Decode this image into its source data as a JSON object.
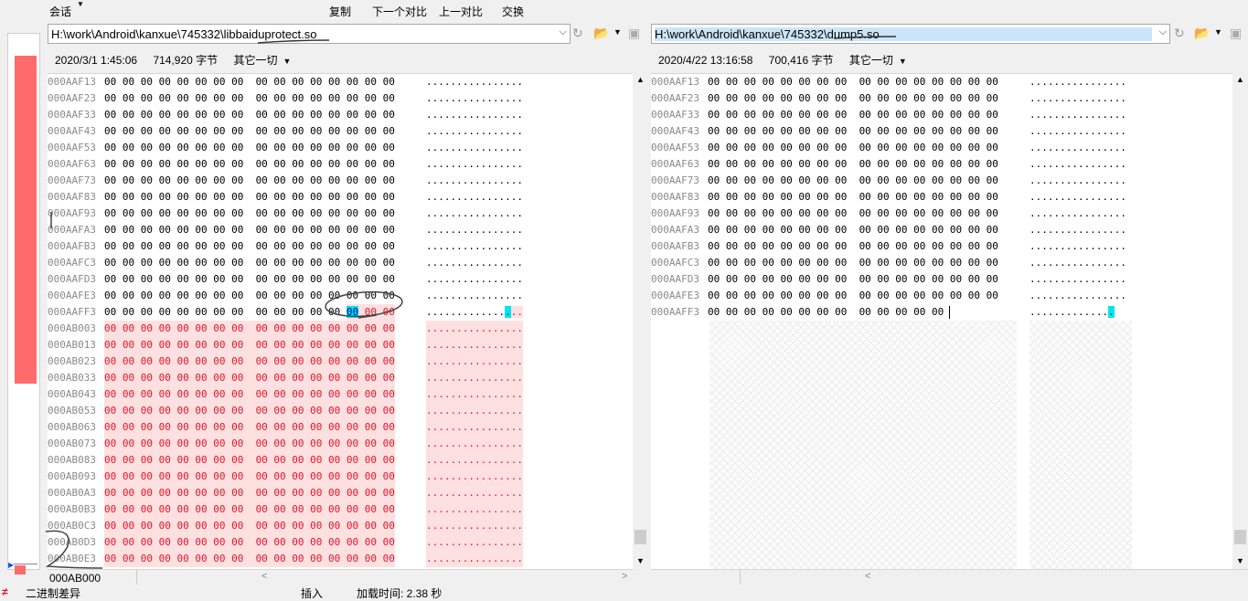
{
  "toolbar": {
    "session": "会话",
    "copy": "复制",
    "next_diff": "下一个对比",
    "prev_diff": "上一对比",
    "swap": "交换"
  },
  "left": {
    "path": "H:\\work\\Android\\kanxue\\745332\\libbaiduprotect.so",
    "date": "2020/3/1 1:45:06",
    "size": "714,920 字节",
    "encoding": "其它一切",
    "offset": "000AB000",
    "rows": [
      {
        "addr": "000AAF13",
        "bytes": "00 00 00 00 00 00 00 00  00 00 00 00 00 00 00 00",
        "ascii": "................",
        "diff": false
      },
      {
        "addr": "000AAF23",
        "bytes": "00 00 00 00 00 00 00 00  00 00 00 00 00 00 00 00",
        "ascii": "................",
        "diff": false
      },
      {
        "addr": "000AAF33",
        "bytes": "00 00 00 00 00 00 00 00  00 00 00 00 00 00 00 00",
        "ascii": "................",
        "diff": false
      },
      {
        "addr": "000AAF43",
        "bytes": "00 00 00 00 00 00 00 00  00 00 00 00 00 00 00 00",
        "ascii": "................",
        "diff": false
      },
      {
        "addr": "000AAF53",
        "bytes": "00 00 00 00 00 00 00 00  00 00 00 00 00 00 00 00",
        "ascii": "................",
        "diff": false
      },
      {
        "addr": "000AAF63",
        "bytes": "00 00 00 00 00 00 00 00  00 00 00 00 00 00 00 00",
        "ascii": "................",
        "diff": false
      },
      {
        "addr": "000AAF73",
        "bytes": "00 00 00 00 00 00 00 00  00 00 00 00 00 00 00 00",
        "ascii": "................",
        "diff": false
      },
      {
        "addr": "000AAF83",
        "bytes": "00 00 00 00 00 00 00 00  00 00 00 00 00 00 00 00",
        "ascii": "................",
        "diff": false
      },
      {
        "addr": "000AAF93",
        "bytes": "00 00 00 00 00 00 00 00  00 00 00 00 00 00 00 00",
        "ascii": "................",
        "diff": false
      },
      {
        "addr": "000AAFA3",
        "bytes": "00 00 00 00 00 00 00 00  00 00 00 00 00 00 00 00",
        "ascii": "................",
        "diff": false
      },
      {
        "addr": "000AAFB3",
        "bytes": "00 00 00 00 00 00 00 00  00 00 00 00 00 00 00 00",
        "ascii": "................",
        "diff": false
      },
      {
        "addr": "000AAFC3",
        "bytes": "00 00 00 00 00 00 00 00  00 00 00 00 00 00 00 00",
        "ascii": "................",
        "diff": false
      },
      {
        "addr": "000AAFD3",
        "bytes": "00 00 00 00 00 00 00 00  00 00 00 00 00 00 00 00",
        "ascii": "................",
        "diff": false
      },
      {
        "addr": "000AAFE3",
        "bytes": "00 00 00 00 00 00 00 00  00 00 00 00 00 00 00 00",
        "ascii": "................",
        "diff": false
      },
      {
        "addr": "000AAFF3",
        "bytes": "00 00 00 00 00 00 00 00  00 00 00 00 00 ",
        "tail": "00 00 00",
        "ascii": ".............",
        "ascii_tail": "...",
        "diff": "partial"
      },
      {
        "addr": "000AB003",
        "bytes": "00 00 00 00 00 00 00 00  00 00 00 00 00 00 00 00",
        "ascii": "................",
        "diff": true
      },
      {
        "addr": "000AB013",
        "bytes": "00 00 00 00 00 00 00 00  00 00 00 00 00 00 00 00",
        "ascii": "................",
        "diff": true
      },
      {
        "addr": "000AB023",
        "bytes": "00 00 00 00 00 00 00 00  00 00 00 00 00 00 00 00",
        "ascii": "................",
        "diff": true
      },
      {
        "addr": "000AB033",
        "bytes": "00 00 00 00 00 00 00 00  00 00 00 00 00 00 00 00",
        "ascii": "................",
        "diff": true
      },
      {
        "addr": "000AB043",
        "bytes": "00 00 00 00 00 00 00 00  00 00 00 00 00 00 00 00",
        "ascii": "................",
        "diff": true
      },
      {
        "addr": "000AB053",
        "bytes": "00 00 00 00 00 00 00 00  00 00 00 00 00 00 00 00",
        "ascii": "................",
        "diff": true
      },
      {
        "addr": "000AB063",
        "bytes": "00 00 00 00 00 00 00 00  00 00 00 00 00 00 00 00",
        "ascii": "................",
        "diff": true
      },
      {
        "addr": "000AB073",
        "bytes": "00 00 00 00 00 00 00 00  00 00 00 00 00 00 00 00",
        "ascii": "................",
        "diff": true
      },
      {
        "addr": "000AB083",
        "bytes": "00 00 00 00 00 00 00 00  00 00 00 00 00 00 00 00",
        "ascii": "................",
        "diff": true
      },
      {
        "addr": "000AB093",
        "bytes": "00 00 00 00 00 00 00 00  00 00 00 00 00 00 00 00",
        "ascii": "................",
        "diff": true
      },
      {
        "addr": "000AB0A3",
        "bytes": "00 00 00 00 00 00 00 00  00 00 00 00 00 00 00 00",
        "ascii": "................",
        "diff": true
      },
      {
        "addr": "000AB0B3",
        "bytes": "00 00 00 00 00 00 00 00  00 00 00 00 00 00 00 00",
        "ascii": "................",
        "diff": true
      },
      {
        "addr": "000AB0C3",
        "bytes": "00 00 00 00 00 00 00 00  00 00 00 00 00 00 00 00",
        "ascii": "................",
        "diff": true
      },
      {
        "addr": "000AB0D3",
        "bytes": "00 00 00 00 00 00 00 00  00 00 00 00 00 00 00 00",
        "ascii": "................",
        "diff": true
      },
      {
        "addr": "000AB0E3",
        "bytes": "00 00 00 00 00 00 00 00  00 00 00 00 00 00 00 00",
        "ascii": "................",
        "diff": true
      }
    ]
  },
  "right": {
    "path": "H:\\work\\Android\\kanxue\\745332\\dump5.so",
    "date": "2020/4/22 13:16:58",
    "size": "700,416 字节",
    "encoding": "其它一切",
    "rows": [
      {
        "addr": "000AAF13",
        "bytes": "00 00 00 00 00 00 00 00  00 00 00 00 00 00 00 00",
        "ascii": "................"
      },
      {
        "addr": "000AAF23",
        "bytes": "00 00 00 00 00 00 00 00  00 00 00 00 00 00 00 00",
        "ascii": "................"
      },
      {
        "addr": "000AAF33",
        "bytes": "00 00 00 00 00 00 00 00  00 00 00 00 00 00 00 00",
        "ascii": "................"
      },
      {
        "addr": "000AAF43",
        "bytes": "00 00 00 00 00 00 00 00  00 00 00 00 00 00 00 00",
        "ascii": "................"
      },
      {
        "addr": "000AAF53",
        "bytes": "00 00 00 00 00 00 00 00  00 00 00 00 00 00 00 00",
        "ascii": "................"
      },
      {
        "addr": "000AAF63",
        "bytes": "00 00 00 00 00 00 00 00  00 00 00 00 00 00 00 00",
        "ascii": "................"
      },
      {
        "addr": "000AAF73",
        "bytes": "00 00 00 00 00 00 00 00  00 00 00 00 00 00 00 00",
        "ascii": "................"
      },
      {
        "addr": "000AAF83",
        "bytes": "00 00 00 00 00 00 00 00  00 00 00 00 00 00 00 00",
        "ascii": "................"
      },
      {
        "addr": "000AAF93",
        "bytes": "00 00 00 00 00 00 00 00  00 00 00 00 00 00 00 00",
        "ascii": "................"
      },
      {
        "addr": "000AAFA3",
        "bytes": "00 00 00 00 00 00 00 00  00 00 00 00 00 00 00 00",
        "ascii": "................"
      },
      {
        "addr": "000AAFB3",
        "bytes": "00 00 00 00 00 00 00 00  00 00 00 00 00 00 00 00",
        "ascii": "................"
      },
      {
        "addr": "000AAFC3",
        "bytes": "00 00 00 00 00 00 00 00  00 00 00 00 00 00 00 00",
        "ascii": "................"
      },
      {
        "addr": "000AAFD3",
        "bytes": "00 00 00 00 00 00 00 00  00 00 00 00 00 00 00 00",
        "ascii": "................"
      },
      {
        "addr": "000AAFE3",
        "bytes": "00 00 00 00 00 00 00 00  00 00 00 00 00 00 00 00",
        "ascii": "................"
      },
      {
        "addr": "000AAFF3",
        "bytes": "00 00 00 00 00 00 00 00  00 00 00 00 00",
        "ascii": ".............",
        "end": true
      }
    ]
  },
  "status": {
    "mode": "二进制差异",
    "insert": "插入",
    "load_time": "加载时间: 2.38 秒"
  },
  "colors": {
    "diff_red": "#e0162b",
    "diff_bg": "#ffe0e0",
    "highlight": "#00e5ee",
    "minimap_red": "#ff6b6b"
  }
}
